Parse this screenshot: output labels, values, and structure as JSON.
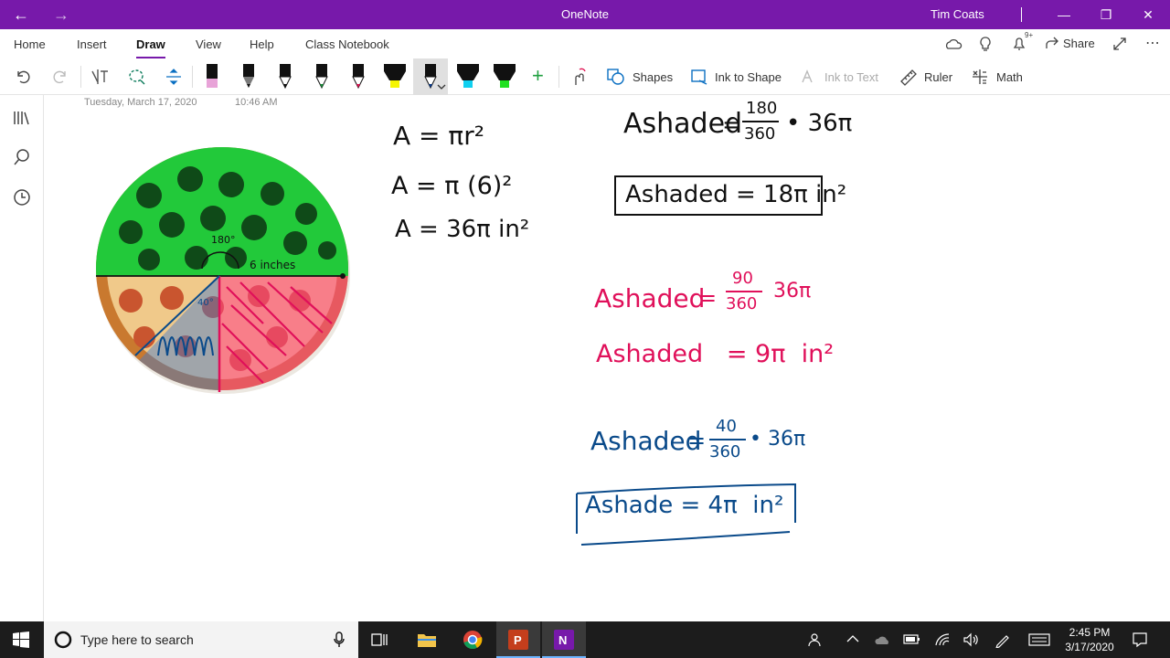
{
  "titlebar": {
    "app_title": "OneNote",
    "user_name": "Tim Coats",
    "back_icon": "←",
    "forward_icon": "→",
    "minimize_icon": "—",
    "restore_icon": "❐",
    "close_icon": "✕"
  },
  "ribbon_tabs": [
    {
      "label": "Home"
    },
    {
      "label": "Insert"
    },
    {
      "label": "Draw"
    },
    {
      "label": "View"
    },
    {
      "label": "Help"
    },
    {
      "label": "Class Notebook"
    }
  ],
  "active_tab": "Draw",
  "top_right": {
    "share_label": "Share",
    "notification_badge": "9+"
  },
  "toolbar": {
    "shapes_label": "Shapes",
    "ink_to_shape_label": "Ink to Shape",
    "ink_to_text_label": "Ink to Text",
    "ruler_label": "Ruler",
    "math_label": "Math",
    "pen_colors": [
      "#e8a3d8",
      "#1a1a1a",
      "#1a1a1a",
      "#1a8a3a",
      "#e01050",
      "#f5f500",
      "#0a3a8a",
      "#10d0f0",
      "#20e020"
    ],
    "add_pen_icon": "+"
  },
  "page": {
    "date": "Tuesday, March 17, 2020",
    "time": "10:46 AM"
  },
  "ink": {
    "left_col": [
      "A = πr²",
      "A = π (6)²",
      "A = 36π in²"
    ],
    "black_eq_lhs": "Ashaded",
    "black_eq_frac_num": "180",
    "black_eq_frac_den": "360",
    "black_eq_rhs": "• 36π",
    "black_result": "Ashaded = 18π in²",
    "pink_eq1_lhs": "Ashaded",
    "pink_eq1_num": "90",
    "pink_eq1_den": "360",
    "pink_eq1_rhs": "36π",
    "pink_eq2": "Ashaded   = 9π  in²",
    "blue_eq_lhs": "Ashaded",
    "blue_eq_num": "40",
    "blue_eq_den": "360",
    "blue_eq_rhs": "• 36π",
    "blue_result": "Ashade = 4π  in²",
    "pizza_radius_label": "6 inches",
    "pizza_angle_label": "40°",
    "pizza_top_angle": "180°"
  },
  "colors": {
    "accent": "#7719aa",
    "ink_black": "#111111",
    "ink_pink": "#e0105a",
    "ink_blue": "#0a4a8a",
    "ink_green": "#22c93a"
  },
  "taskbar": {
    "search_placeholder": "Type here to search",
    "time": "2:45 PM",
    "date": "3/17/2020"
  }
}
